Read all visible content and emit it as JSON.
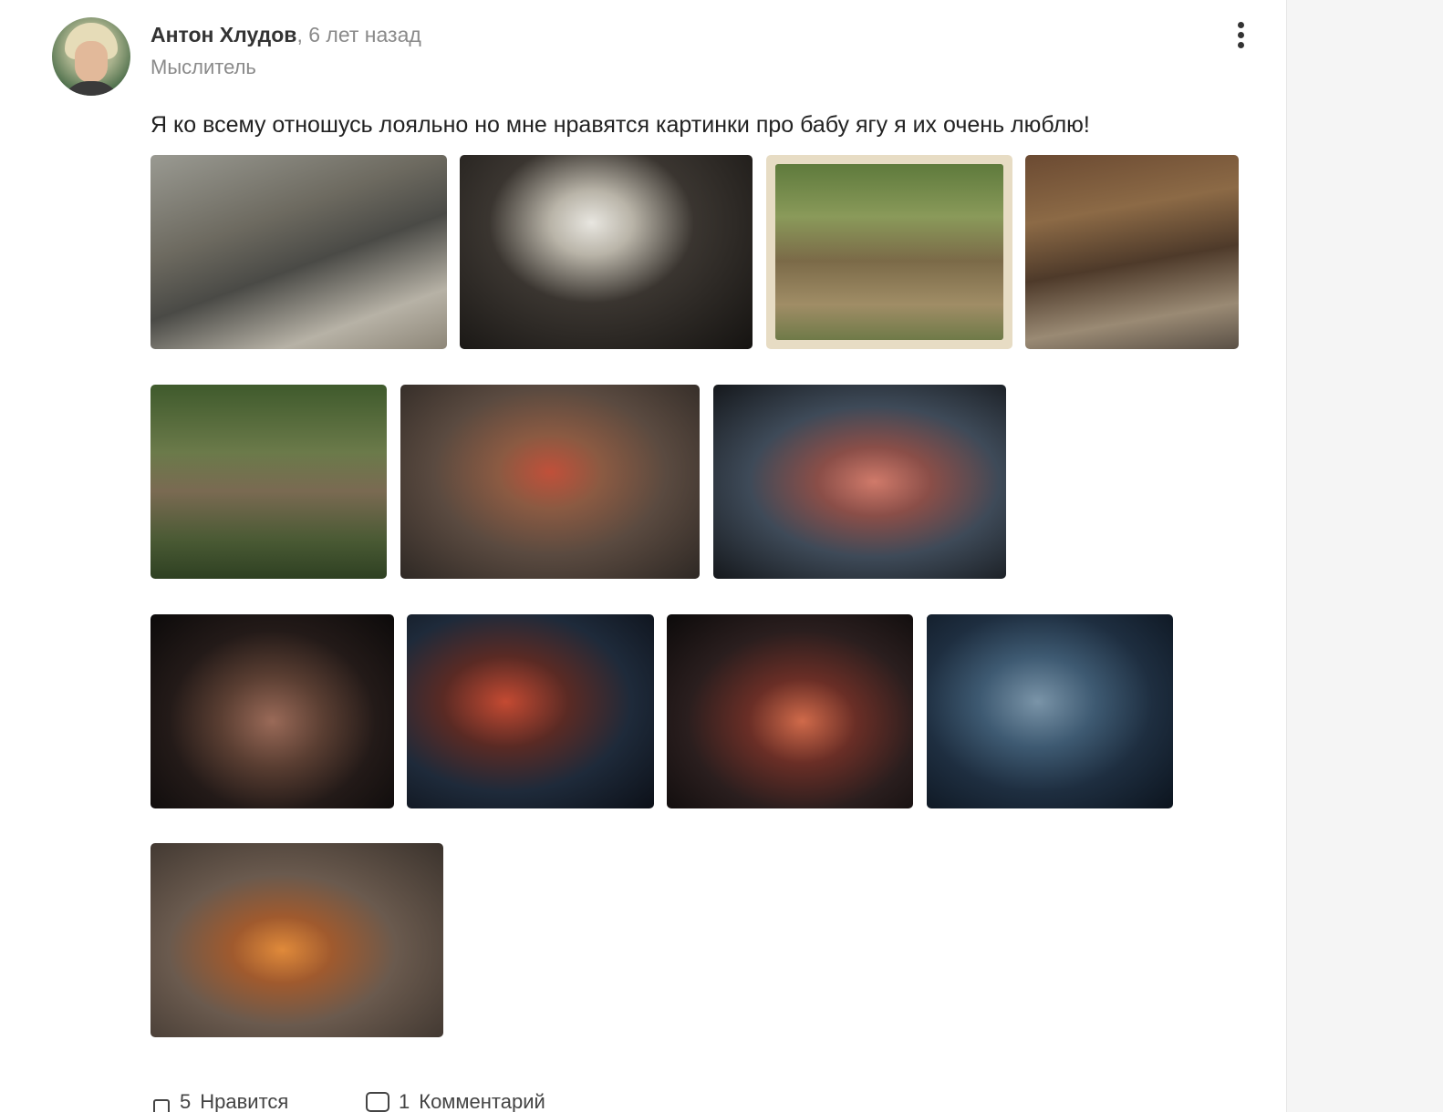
{
  "post": {
    "author": {
      "name": "Антон Хлудов",
      "separator": ",",
      "time": "6 лет назад",
      "rank": "Мыслитель"
    },
    "text": "Я ко всему отношусь лояльно но мне нравятся картинки про бабу ягу я их очень люблю!",
    "photo_count": 12,
    "actions": {
      "likes_count": "5",
      "likes_label": "Нравится",
      "comments_count": "1",
      "comments_label": "Комментарий"
    }
  },
  "icons": {
    "more": "more-vertical-icon",
    "like": "like-icon",
    "comment": "comment-icon"
  }
}
